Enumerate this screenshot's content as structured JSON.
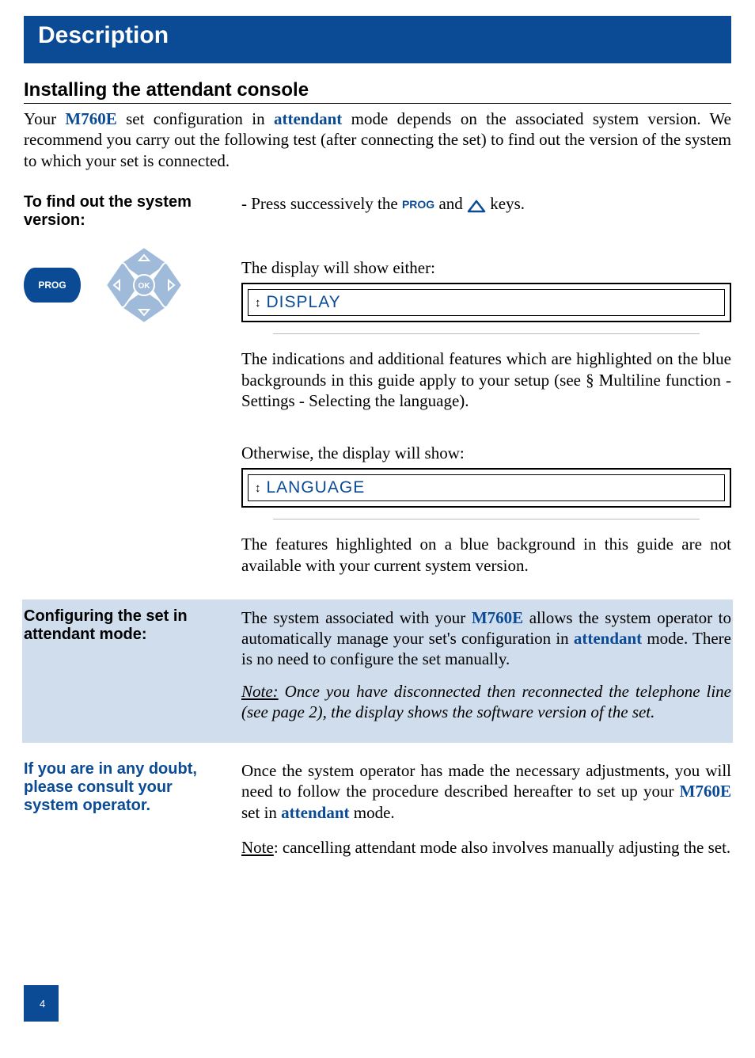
{
  "header": {
    "title": "Description"
  },
  "section": {
    "heading": "Installing the attendant console",
    "intro": {
      "pre": "Your ",
      "model": "M760E",
      "mid1": " set configuration in ",
      "mode": "attendant",
      "mid2": " mode depends on the associated system version. We recommend you carry out the following test (after connecting the set) to find out the version of the system to which your set is connected."
    }
  },
  "block1": {
    "left": "To find out the system version:",
    "line": {
      "pre": "- Press successively the ",
      "prog": "PROG",
      "mid": " and ",
      "post": " keys."
    },
    "show_either": "The display will show either:",
    "display1": "DISPLAY",
    "explain1": "The indications and additional features which are highlighted on the blue backgrounds in this guide apply to your setup (see § Multiline function - Settings - Selecting the language).",
    "otherwise": "Otherwise, the display will show:",
    "display2": "LANGUAGE",
    "explain2": "The features highlighted on a blue background in this guide are not available with your current system version."
  },
  "block2": {
    "left": "Configuring the set in attendant mode:",
    "p1_pre": "The system associated with your ",
    "p1_model": "M760E",
    "p1_mid": " allows the system operator to automatically manage your set's configuration in ",
    "p1_mode": "attendant",
    "p1_post": " mode. There is no need to configure the set manually.",
    "note_label": "Note:",
    "note_text": " Once you have disconnected then reconnected the telephone line (see page 2), the display shows the software version of the set."
  },
  "block3": {
    "left": "If you are in any doubt, please consult your system operator.",
    "p1_pre": "Once the system operator has made the necessary adjustments, you will need to follow the procedure described hereafter to set up your ",
    "p1_model": "M760E",
    "p1_mid": " set in ",
    "p1_mode": "attendant",
    "p1_post": " mode.",
    "p2_note": "Note",
    "p2_text": ": cancelling attendant mode also involves manually adjusting the set."
  },
  "page_number": "4"
}
